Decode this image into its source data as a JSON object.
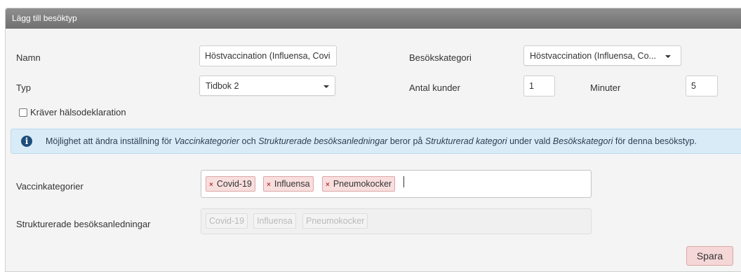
{
  "panel": {
    "title": "Lägg till besöktyp"
  },
  "form": {
    "namn_label": "Namn",
    "namn_value": "Höstvaccination (Influensa, Covi",
    "besokskategori_label": "Besökskategori",
    "besokskategori_value": "Höstvaccination (Influensa, Co...",
    "typ_label": "Typ",
    "typ_value": "Tidbok 2",
    "antal_kunder_label": "Antal kunder",
    "antal_kunder_value": "1",
    "minuter_label": "Minuter",
    "minuter_value": "5",
    "halsodeklaration_label": "Kräver hälsodeklaration",
    "halsodeklaration_checked": false
  },
  "info": {
    "icon": "info-circle-icon",
    "parts": [
      {
        "text": "Möjlighet att ändra inställning för ",
        "italic": false
      },
      {
        "text": "Vaccinkategorier",
        "italic": true
      },
      {
        "text": " och ",
        "italic": false
      },
      {
        "text": "Strukturerade besöksanledningar",
        "italic": true
      },
      {
        "text": " beror på ",
        "italic": false
      },
      {
        "text": "Strukturerad kategori",
        "italic": true
      },
      {
        "text": " under vald ",
        "italic": false
      },
      {
        "text": "Besökskategori",
        "italic": true
      },
      {
        "text": " för denna besökstyp.",
        "italic": false
      }
    ]
  },
  "vaccinkategorier": {
    "label": "Vaccinkategorier",
    "tags": [
      "Covid-19",
      "Influensa",
      "Pneumokocker"
    ]
  },
  "strukturerade": {
    "label": "Strukturerade besöksanledningar",
    "tags": [
      "Covid-19",
      "Influensa",
      "Pneumokocker"
    ]
  },
  "actions": {
    "save_label": "Spara"
  },
  "colors": {
    "header": "#7f7f7f",
    "info_bg": "#d9ebf7",
    "tag_bg": "#f9dede",
    "button_bg": "#f5d7d7"
  }
}
